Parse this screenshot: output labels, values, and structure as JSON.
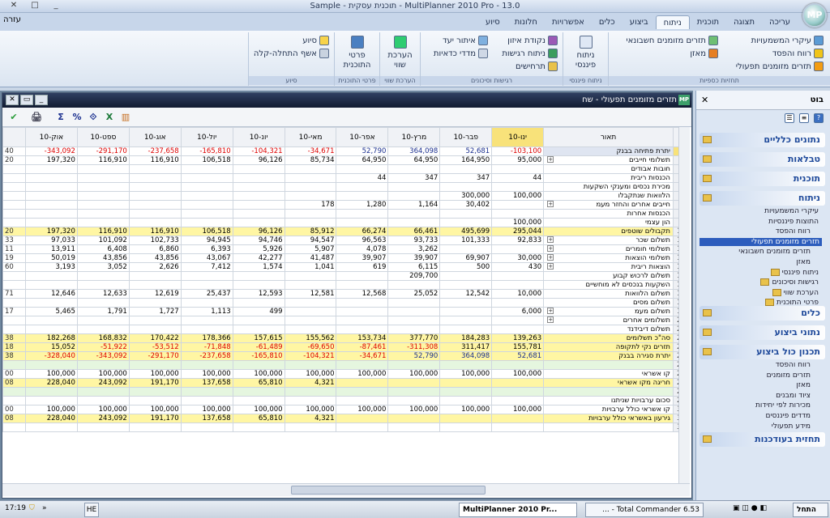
{
  "app": {
    "title": "Sample - תוכנית עסקית - MultiPlanner 2010 Pro - 13.0",
    "logo": "MP",
    "help_menu": "עזרה"
  },
  "ribbon_tabs": [
    "עריכה",
    "תצוגה",
    "תוכנית",
    "ניתוח",
    "ביצוע",
    "כלים",
    "אפשרויות",
    "חלונות",
    "סיוע"
  ],
  "ribbon_active": "ניתוח",
  "ribbon": {
    "g1": {
      "label": "תחזיות כספיות",
      "items": [
        "עיקרי המשמעויות",
        "רווח והפסד",
        "תזרים מזומנים תפעולי",
        "תזרים מזומנים חשבונאי",
        "מאזן"
      ]
    },
    "g2": {
      "label": "ניתוח פיננסי",
      "big": "ניתוח פיננסי"
    },
    "g3": {
      "label": "רגישות וסיכונים",
      "items": [
        "נקודת איזון",
        "איתור יעד",
        "ניתוח רגישות",
        "מדדי כדאיות",
        "תרחישים"
      ]
    },
    "g4": {
      "label": "הערכת שווי",
      "big": "הערכת שווי"
    },
    "g5": {
      "label": "פרטי התוכנית",
      "big": "פרטי התוכנית"
    },
    "g6": {
      "label": "סיוע",
      "items": [
        "סיוע",
        "אשף התחלה-קלה"
      ]
    }
  },
  "doc": {
    "title": "תזרים מזומנים תפעולי - שח",
    "logo": "MP"
  },
  "toolbar": [
    "✔",
    "🖨",
    "Σ",
    "%",
    "⟐",
    "X",
    "▥"
  ],
  "table": {
    "desc_header": "תאור",
    "months": [
      "ינו-10",
      "פבר-10",
      "מרץ-10",
      "אפר-10",
      "מאי-10",
      "יונ-10",
      "יול-10",
      "אוג-10",
      "ספט-10",
      "אוק-10"
    ],
    "partial_header": "",
    "rows": [
      {
        "n": "1",
        "d": "יתרת פתיחה בבנק",
        "v": [
          "-103,100",
          "52,681",
          "364,098",
          "52,790",
          "-34,671",
          "-104,321",
          "-165,810",
          "-237,658",
          "-291,170",
          "-343,092"
        ],
        "p": "40",
        "style": "bluehl"
      },
      {
        "n": "2",
        "d": "תשלומי חייבים",
        "x": true,
        "v": [
          "95,000",
          "164,950",
          "64,950",
          "64,950",
          "85,734",
          "96,126",
          "106,518",
          "116,910",
          "116,910",
          "197,320"
        ],
        "p": "20"
      },
      {
        "n": "3",
        "d": "חובות אבודים",
        "v": [
          "",
          "",
          "",
          "",
          "",
          "",
          "",
          "",
          "",
          ""
        ],
        "p": ""
      },
      {
        "n": "4",
        "d": "הכנסות ריבית",
        "v": [
          "44",
          "347",
          "347",
          "44",
          "",
          "",
          "",
          "",
          "",
          ""
        ],
        "p": ""
      },
      {
        "n": "5",
        "d": "מכירת נכסים ומענקי השקעות",
        "v": [
          "",
          "",
          "",
          "",
          "",
          "",
          "",
          "",
          "",
          ""
        ],
        "p": ""
      },
      {
        "n": "6",
        "d": "הלוואות שנתקבלו",
        "v": [
          "100,000",
          "300,000",
          "",
          "",
          "",
          "",
          "",
          "",
          "",
          ""
        ],
        "p": ""
      },
      {
        "n": "7",
        "d": "חייבים אחרים והחזר מעמ",
        "x": true,
        "v": [
          "",
          "30,402",
          "1,164",
          "1,280",
          "178",
          "",
          "",
          "",
          "",
          ""
        ],
        "p": ""
      },
      {
        "n": "8",
        "d": "הכנסות אחרות",
        "v": [
          "",
          "",
          "",
          "",
          "",
          "",
          "",
          "",
          "",
          ""
        ],
        "p": ""
      },
      {
        "n": "9",
        "d": "הון עצמי",
        "v": [
          "100,000",
          "",
          "",
          "",
          "",
          "",
          "",
          "",
          "",
          ""
        ],
        "p": ""
      },
      {
        "n": "10",
        "d": "תקבולים שוטפים",
        "v": [
          "295,044",
          "495,699",
          "66,461",
          "66,274",
          "85,912",
          "96,126",
          "106,518",
          "116,910",
          "116,910",
          "197,320"
        ],
        "p": "20",
        "style": "yellow"
      },
      {
        "n": "11",
        "d": "תשלום שכר",
        "x": true,
        "v": [
          "92,833",
          "101,333",
          "93,733",
          "96,563",
          "94,547",
          "94,746",
          "94,945",
          "102,733",
          "101,092",
          "97,033"
        ],
        "p": "33"
      },
      {
        "n": "12",
        "d": "תשלומי חומרים",
        "x": true,
        "v": [
          "",
          "",
          "3,262",
          "4,078",
          "5,907",
          "5,926",
          "6,393",
          "6,860",
          "6,408",
          "13,911"
        ],
        "p": "11"
      },
      {
        "n": "13",
        "d": "תשלומי הוצאות",
        "x": true,
        "v": [
          "30,000",
          "69,907",
          "39,907",
          "39,907",
          "41,487",
          "42,277",
          "43,067",
          "43,856",
          "43,856",
          "50,019"
        ],
        "p": "19"
      },
      {
        "n": "14",
        "d": "הוצאות ריבית",
        "x": true,
        "v": [
          "430",
          "500",
          "6,115",
          "619",
          "1,041",
          "1,574",
          "7,412",
          "2,626",
          "3,052",
          "3,193"
        ],
        "p": "60"
      },
      {
        "n": "15",
        "d": "תשלום לרכוש קבוע",
        "v": [
          "",
          "",
          "209,700",
          "",
          "",
          "",
          "",
          "",
          "",
          ""
        ],
        "p": ""
      },
      {
        "n": "16",
        "d": "השקעות בנכסים לא מוחשיים",
        "v": [
          "",
          "",
          "",
          "",
          "",
          "",
          "",
          "",
          "",
          ""
        ],
        "p": ""
      },
      {
        "n": "17",
        "d": "תשלום הלוואות",
        "v": [
          "10,000",
          "12,542",
          "25,052",
          "12,568",
          "12,581",
          "12,593",
          "25,437",
          "12,619",
          "12,633",
          "12,646"
        ],
        "p": "71"
      },
      {
        "n": "18",
        "d": "תשלום מסים",
        "v": [
          "",
          "",
          "",
          "",
          "",
          "",
          "",
          "",
          "",
          ""
        ],
        "p": ""
      },
      {
        "n": "19",
        "d": "תשלום מעמ",
        "x": true,
        "v": [
          "6,000",
          "",
          "",
          "",
          "",
          "499",
          "1,113",
          "1,727",
          "1,791",
          "5,465"
        ],
        "p": "17"
      },
      {
        "n": "20",
        "d": "תשלומים אחרים",
        "x": true,
        "v": [
          "",
          "",
          "",
          "",
          "",
          "",
          "",
          "",
          "",
          ""
        ],
        "p": ""
      },
      {
        "n": "21",
        "d": "תשלום דיבידנד",
        "v": [
          "",
          "",
          "",
          "",
          "",
          "",
          "",
          "",
          "",
          ""
        ],
        "p": ""
      },
      {
        "n": "22",
        "d": "סה\"כ תשלומים",
        "v": [
          "139,263",
          "184,283",
          "377,770",
          "153,734",
          "155,562",
          "157,615",
          "178,366",
          "170,422",
          "168,832",
          "182,268"
        ],
        "p": "38",
        "style": "yellow"
      },
      {
        "n": "23",
        "d": "תזרים נקי לתקופה",
        "v": [
          "155,781",
          "311,417",
          "-311,308",
          "-87,461",
          "-69,650",
          "-61,489",
          "-71,848",
          "-53,512",
          "-51,922",
          "15,052"
        ],
        "p": "18",
        "style": "yellow"
      },
      {
        "n": "24",
        "d": "יתרת סגירה בבנק",
        "v": [
          "52,681",
          "364,098",
          "52,790",
          "-34,671",
          "-104,321",
          "-165,810",
          "-237,658",
          "-291,170",
          "-343,092",
          "-328,040"
        ],
        "p": "38",
        "style": "yellow"
      },
      {
        "n": "25",
        "d": "",
        "v": [
          "",
          "",
          "",
          "",
          "",
          "",
          "",
          "",
          "",
          ""
        ],
        "p": "",
        "style": "green"
      },
      {
        "n": "26",
        "d": "קו אשראי",
        "v": [
          "100,000",
          "100,000",
          "100,000",
          "100,000",
          "100,000",
          "100,000",
          "100,000",
          "100,000",
          "100,000",
          "100,000"
        ],
        "p": "00"
      },
      {
        "n": "27",
        "d": "חריגה מקו אשראי",
        "v": [
          "",
          "",
          "",
          "",
          "4,321",
          "65,810",
          "137,658",
          "191,170",
          "243,092",
          "228,040"
        ],
        "p": "08",
        "style": "yellow"
      },
      {
        "n": "28",
        "d": "",
        "v": [
          "",
          "",
          "",
          "",
          "",
          "",
          "",
          "",
          "",
          ""
        ],
        "p": "",
        "style": "green"
      },
      {
        "n": "29",
        "d": "סכום ערבויות שניתנו",
        "v": [
          "",
          "",
          "",
          "",
          "",
          "",
          "",
          "",
          "",
          ""
        ],
        "p": ""
      },
      {
        "n": "30",
        "d": "קו אשראי כולל ערבויות",
        "v": [
          "100,000",
          "100,000",
          "100,000",
          "100,000",
          "100,000",
          "100,000",
          "100,000",
          "100,000",
          "100,000",
          "100,000"
        ],
        "p": "00"
      },
      {
        "n": "31",
        "d": "גירעון באשראי כולל ערבויות",
        "v": [
          "",
          "",
          "",
          "",
          "4,321",
          "65,810",
          "137,658",
          "191,170",
          "243,092",
          "228,040"
        ],
        "p": "08",
        "style": "yellow"
      },
      {
        "n": "32",
        "d": "",
        "v": [
          "",
          "",
          "",
          "",
          "",
          "",
          "",
          "",
          "",
          ""
        ],
        "p": ""
      }
    ]
  },
  "taskpane": {
    "title": "בוט",
    "sections": [
      "נתונים כלליים",
      "טבלאות",
      "תוכנית",
      "ניתוח",
      "כלים",
      "נתוני ביצוע",
      "תכנון כול ביצוע",
      "תחזית בעודכנות"
    ],
    "analysis_items": [
      "עיקרי המשמעויות",
      "התוצות פיננסיות",
      "רווח והפסד",
      "תזרים מזומנים תפעולי",
      "תזרים מזומנים חשבונאי",
      "מאזן",
      "ניתוח פיננסי",
      "רגישות וסיכונים",
      "הערכת שווי",
      "פרטי התוכנית"
    ],
    "exec_items": [
      "רווח והפסד",
      "תזרים מזומנים",
      "מאזן",
      "ציוד ומבנים",
      "מכירות לפי יחידות",
      "מדדים פיננסים",
      "מידע תפעולי"
    ]
  },
  "taskbar": {
    "start": "התחל",
    "tasks": [
      "MultiPlanner 2010 Pr...",
      "Total Commander 6.53 - ..."
    ],
    "clock": "17:19",
    "he": "HE"
  }
}
